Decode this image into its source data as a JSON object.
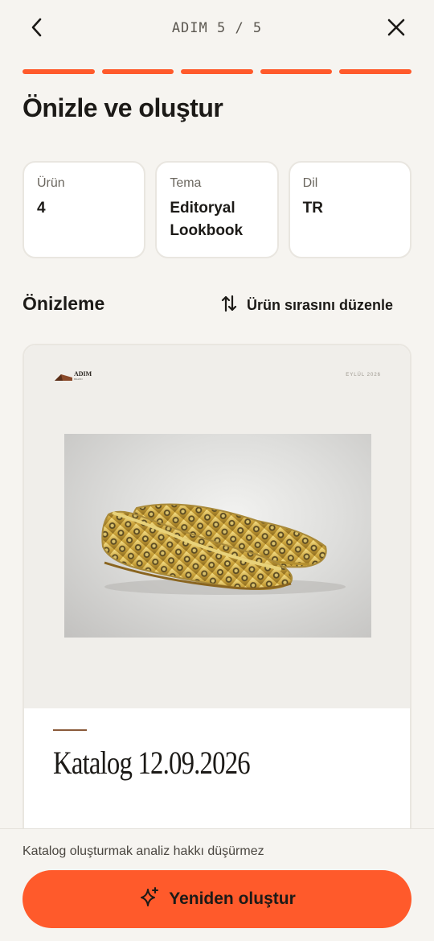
{
  "header": {
    "step_label": "ADIM 5 / 5",
    "back_icon": "chevron-left-icon",
    "close_icon": "close-icon"
  },
  "progress": {
    "total_steps": 5,
    "completed_steps": 5,
    "color": "#ff5a2b"
  },
  "page_title": "Önizle ve oluştur",
  "summary_cards": [
    {
      "label": "Ürün",
      "value": "4"
    },
    {
      "label": "Tema",
      "value": "Editoryal Lookbook"
    },
    {
      "label": "Dil",
      "value": "TR"
    }
  ],
  "preview_section": {
    "title": "Önizleme",
    "reorder_label": "Ürün sırasını düzenle",
    "reorder_icon": "sort-arrows-icon"
  },
  "preview": {
    "brand": "ADIM",
    "brand_sub": "BRAND",
    "date": "EYLÜL 2026",
    "image": "gold-cutout-ballet-flats",
    "catalog_title": "Katalog 12.09.2026"
  },
  "footer": {
    "note": "Katalog oluşturmak analiz hakkı düşürmez",
    "button_label": "Yeniden oluştur",
    "button_icon": "sparkle-icon"
  },
  "colors": {
    "accent": "#ff5a2b",
    "background": "#f6f4f0"
  }
}
